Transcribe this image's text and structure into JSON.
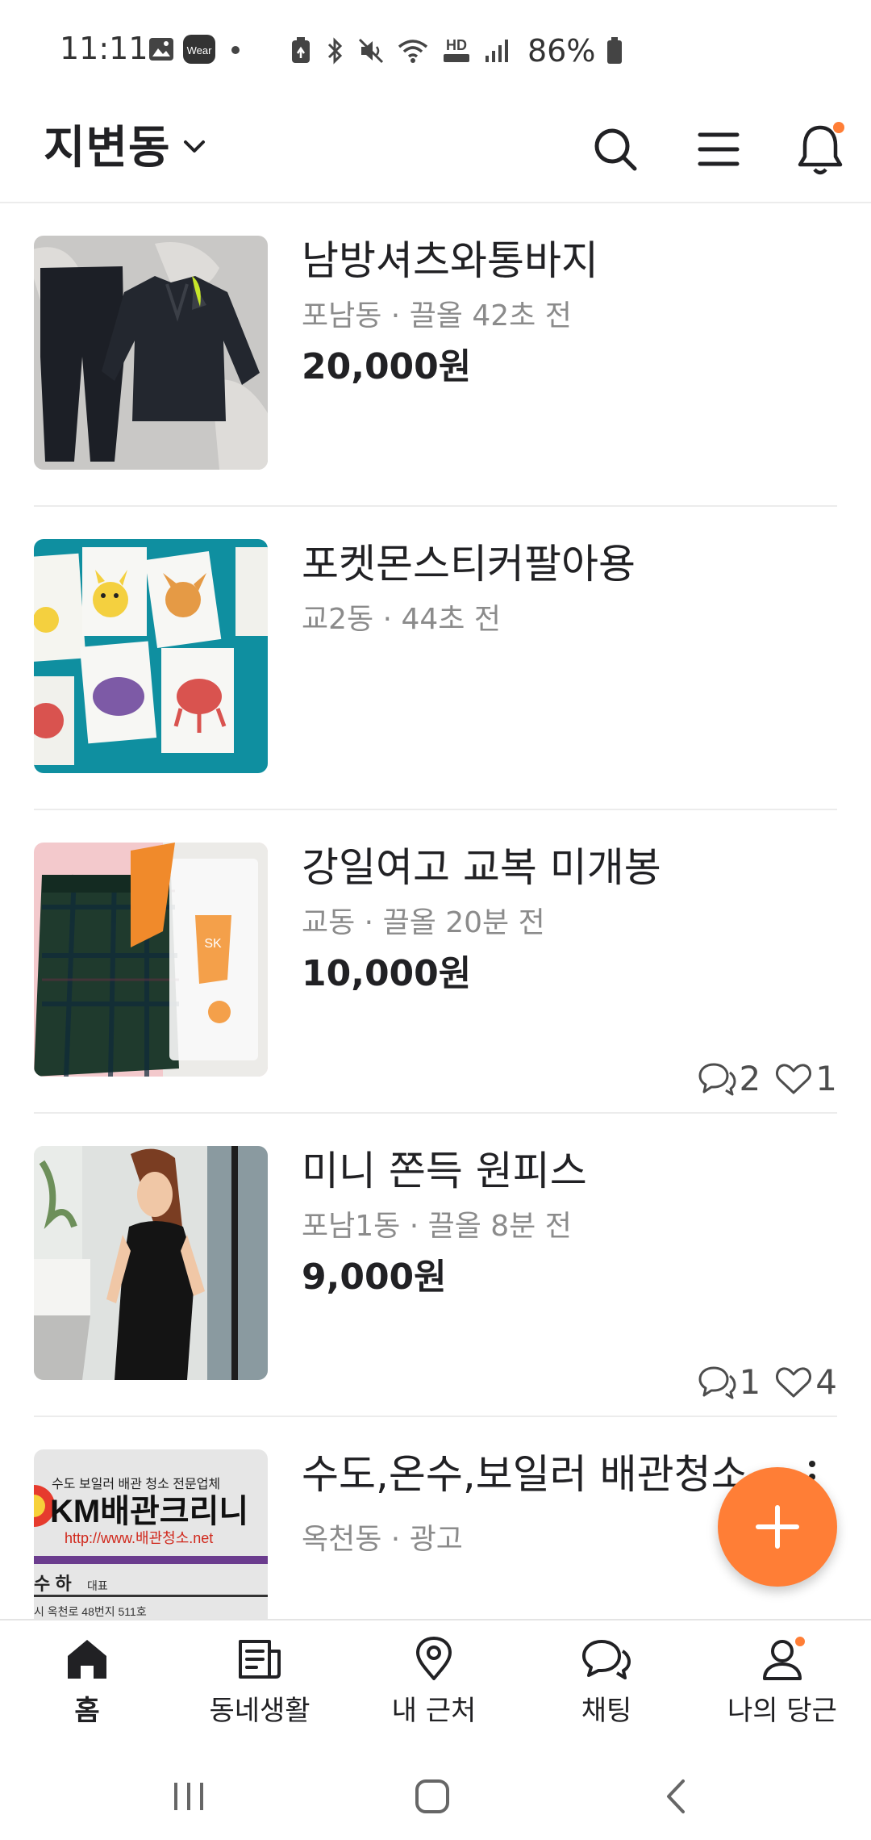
{
  "status_bar": {
    "time": "11:11",
    "wear_badge": "Wear",
    "hd_voice": "HD",
    "battery_percent": "86%"
  },
  "header": {
    "location": "지변동",
    "icons": [
      "search-icon",
      "menu-icon",
      "bell-icon"
    ],
    "notification_dot": true
  },
  "items": [
    {
      "title": "남방셔츠와통바지",
      "meta": "포남동 · 끌올 42초 전",
      "price": "20,000원",
      "comments": "",
      "likes": ""
    },
    {
      "title": "포켓몬스티커팔아용",
      "meta": "교2동 · 44초 전",
      "price": "",
      "comments": "",
      "likes": ""
    },
    {
      "title": "강일여고 교복 미개봉",
      "meta": "교동 · 끌올 20분 전",
      "price": "10,000원",
      "comments": "2",
      "likes": "1"
    },
    {
      "title": "미니 쫀득 원피스",
      "meta": "포남1동 · 끌올 8분 전",
      "price": "9,000원",
      "comments": "1",
      "likes": "4"
    },
    {
      "title": "수도,온수,보일러 배관청소",
      "meta": "옥천동 · 광고",
      "price": "",
      "comments": "",
      "likes": "",
      "ad_image": {
        "line1": "수도 보일러 배관 청소 전문업체",
        "brand": "KM배관크리니",
        "url": "http://www.배관청소.net",
        "name": "수 하",
        "role": "대표",
        "address": "시 옥천로 48번지 511호"
      }
    }
  ],
  "colors": {
    "accent": "#ff7e36",
    "text": "#212124",
    "meta": "#8b8b8b"
  },
  "fab": {
    "icon": "plus-icon"
  },
  "bottom_nav": [
    {
      "label": "홈",
      "icon": "home-icon",
      "active": true
    },
    {
      "label": "동네생활",
      "icon": "neighborhood-icon",
      "active": false
    },
    {
      "label": "내 근처",
      "icon": "location-pin-icon",
      "active": false
    },
    {
      "label": "채팅",
      "icon": "chat-icon",
      "active": false
    },
    {
      "label": "나의 당근",
      "icon": "profile-icon",
      "active": false
    }
  ]
}
